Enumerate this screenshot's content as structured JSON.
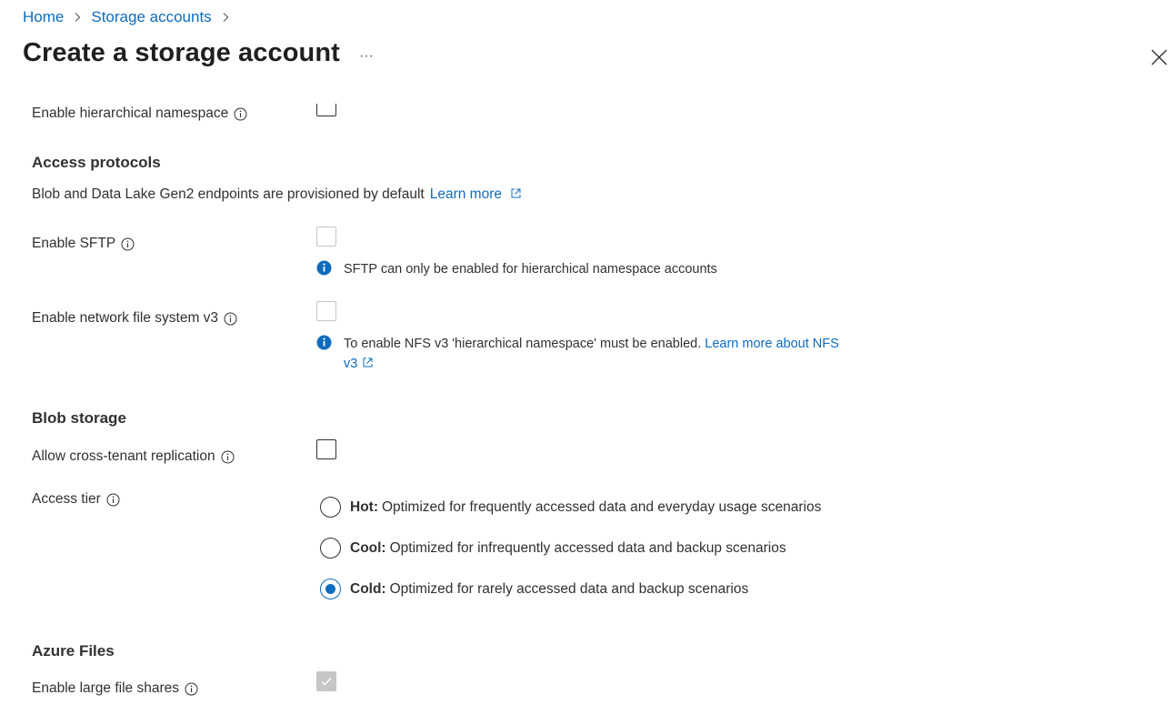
{
  "breadcrumb": {
    "home": "Home",
    "storage_accounts": "Storage accounts"
  },
  "page": {
    "title": "Create a storage account",
    "more": "···"
  },
  "hierarchical": {
    "label": "Enable hierarchical namespace"
  },
  "access_protocols": {
    "heading": "Access protocols",
    "description": "Blob and Data Lake Gen2 endpoints are provisioned by default",
    "learn_more": "Learn more",
    "sftp": {
      "label": "Enable SFTP",
      "note": "SFTP can only be enabled for hierarchical namespace accounts"
    },
    "nfs": {
      "label": "Enable network file system v3",
      "note": "To enable NFS v3 'hierarchical namespace' must be enabled.",
      "note_link_1": "Learn more about NFS",
      "note_link_2": "v3"
    }
  },
  "blob_storage": {
    "heading": "Blob storage",
    "cross_tenant": {
      "label": "Allow cross-tenant replication"
    },
    "access_tier": {
      "label": "Access tier",
      "options": [
        {
          "name": "Hot:",
          "desc": "Optimized for frequently accessed data and everyday usage scenarios",
          "selected": false
        },
        {
          "name": "Cool:",
          "desc": "Optimized for infrequently accessed data and backup scenarios",
          "selected": false
        },
        {
          "name": "Cold:",
          "desc": "Optimized for rarely accessed data and backup scenarios",
          "selected": true
        }
      ]
    }
  },
  "azure_files": {
    "heading": "Azure Files",
    "large_file_shares": {
      "label": "Enable large file shares",
      "checked": true,
      "disabled": true
    }
  },
  "colors": {
    "link": "#0f6cbd",
    "text": "#323130",
    "info_badge": "#0f6cbd",
    "disabled": "#c8c6c4"
  }
}
